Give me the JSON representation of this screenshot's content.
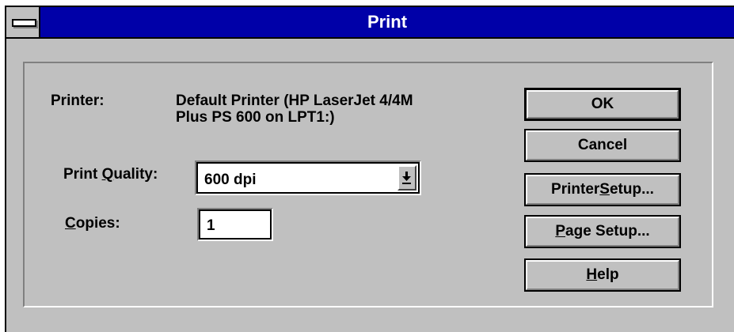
{
  "window": {
    "title": "Print"
  },
  "printer": {
    "label": "Printer:",
    "name_line1": "Default Printer (HP LaserJet 4/4M",
    "name_line2": "Plus PS 600 on LPT1:)"
  },
  "print_quality": {
    "label_before": "Print ",
    "label_accel": "Q",
    "label_after": "uality:",
    "selected": "600 dpi",
    "dropdown_icon": "arrow-down-underline-icon"
  },
  "copies": {
    "label_accel": "C",
    "label_after": "opies:",
    "value": "1"
  },
  "buttons": {
    "ok": "OK",
    "cancel": "Cancel",
    "printer_setup": {
      "before": "Printer ",
      "accel": "S",
      "after": "etup..."
    },
    "page_setup": {
      "before": "",
      "accel": "P",
      "after": "age Setup..."
    },
    "help": {
      "before": "",
      "accel": "H",
      "after": "elp"
    }
  },
  "colors": {
    "titlebar": "#0000a8",
    "face": "#c0c0c0",
    "shadow": "#808080"
  }
}
